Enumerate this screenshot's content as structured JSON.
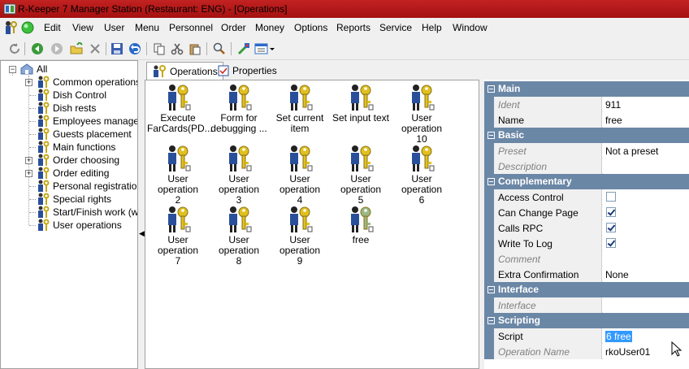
{
  "window": {
    "title": "R-Keeper 7 Manager Station (Restaurant: ENG) - [Operations]"
  },
  "menu": [
    {
      "label": "Edit"
    },
    {
      "label": "View"
    },
    {
      "label": "User"
    },
    {
      "label": "Menu"
    },
    {
      "label": "Personnel"
    },
    {
      "label": "Order"
    },
    {
      "label": "Money"
    },
    {
      "label": "Options"
    },
    {
      "label": "Reports"
    },
    {
      "label": "Service"
    },
    {
      "label": "Help"
    },
    {
      "label": "Window"
    }
  ],
  "tree": {
    "root": "All",
    "items": [
      {
        "label": "Common operations",
        "expandable": true
      },
      {
        "label": "Dish Control",
        "expandable": false
      },
      {
        "label": "Dish rests",
        "expandable": false
      },
      {
        "label": "Employees manageme",
        "expandable": false
      },
      {
        "label": "Guests placement",
        "expandable": false
      },
      {
        "label": "Main functions",
        "expandable": false
      },
      {
        "label": "Order choosing",
        "expandable": true
      },
      {
        "label": "Order editing",
        "expandable": true
      },
      {
        "label": "Personal registration",
        "expandable": false
      },
      {
        "label": "Special rights",
        "expandable": false
      },
      {
        "label": "Start/Finish work (writ",
        "expandable": false
      },
      {
        "label": "User operations",
        "expandable": false,
        "selected": true
      }
    ]
  },
  "tabs": [
    {
      "label": "Operations",
      "active": true
    },
    {
      "label": "Properties",
      "active": false
    }
  ],
  "operations": [
    {
      "label": "Execute\nFarCards(PD..."
    },
    {
      "label": "Form for\ndebugging ..."
    },
    {
      "label": "Set current\nitem"
    },
    {
      "label": "Set input text"
    },
    {
      "label": "User operation\n10"
    },
    {
      "label": "User operation\n2"
    },
    {
      "label": "User operation\n3"
    },
    {
      "label": "User operation\n4"
    },
    {
      "label": "User operation\n5"
    },
    {
      "label": "User operation\n6"
    },
    {
      "label": "User operation\n7"
    },
    {
      "label": "User operation\n8"
    },
    {
      "label": "User operation\n9"
    },
    {
      "label": "free"
    }
  ],
  "properties": {
    "main": {
      "title": "Main",
      "rows": [
        {
          "name": "Ident",
          "value": "911",
          "readonly": true
        },
        {
          "name": "Name",
          "value": "free"
        }
      ]
    },
    "basic": {
      "title": "Basic",
      "rows": [
        {
          "name": "Preset",
          "value": "Not a preset",
          "readonly": true
        },
        {
          "name": "Description",
          "value": "",
          "readonly": true
        }
      ]
    },
    "complementary": {
      "title": "Complementary",
      "rows": [
        {
          "name": "Access Control",
          "checked": false
        },
        {
          "name": "Can Change Page",
          "checked": true
        },
        {
          "name": "Calls RPC",
          "checked": true
        },
        {
          "name": "Write To Log",
          "checked": true
        },
        {
          "name": "Comment",
          "value": "",
          "readonly": true
        },
        {
          "name": "Extra Confirmation",
          "value": "None"
        }
      ]
    },
    "interface": {
      "title": "Interface",
      "rows": [
        {
          "name": "Interface",
          "value": "",
          "readonly": true
        }
      ]
    },
    "scripting": {
      "title": "Scripting",
      "rows": [
        {
          "name": "Script",
          "value": "6 free"
        },
        {
          "name": "Operation Name",
          "value": "rkoUser01",
          "readonly": true
        }
      ]
    }
  },
  "colors": {
    "title_bar": "#b51818",
    "category": "#6b87a6",
    "selection": "#3399ff"
  }
}
